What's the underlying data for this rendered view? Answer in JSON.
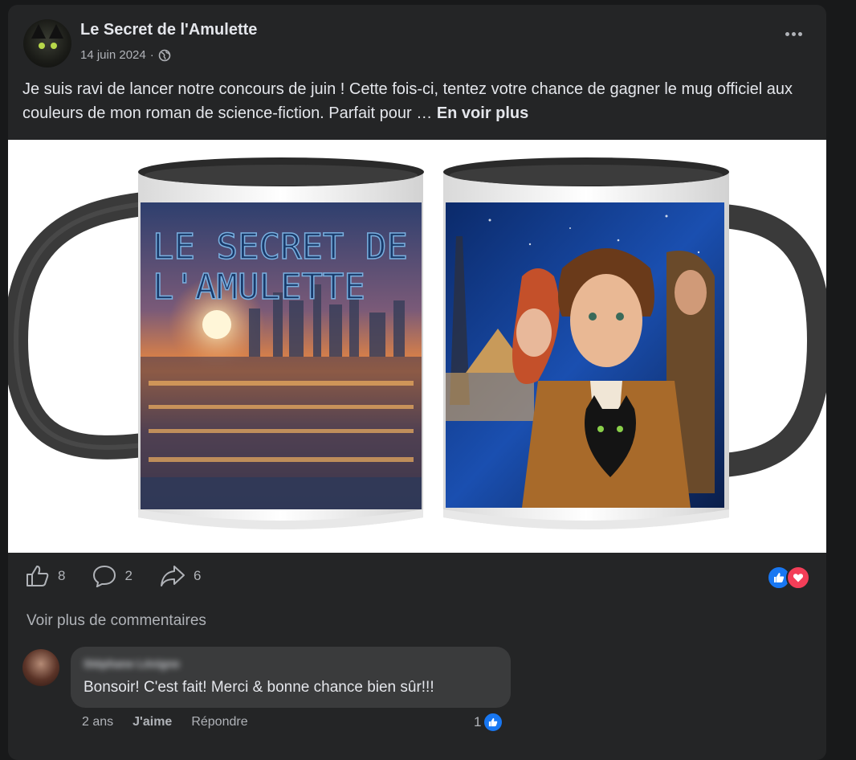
{
  "post": {
    "author": "Le Secret de l'Amulette",
    "date": "14 juin 2024",
    "separator": "·",
    "audience_icon": "globe-icon",
    "text": "Je suis ravi de lancer notre concours de juin ! Cette fois-ci, tentez votre chance de gagner le mug officiel aux couleurs de mon roman de science-fiction. Parfait pour …",
    "see_more": "En voir plus",
    "mug_logo_line1": "LE SECRET DE",
    "mug_logo_line2": "L'AMULETTE"
  },
  "stats": {
    "likes": "8",
    "comments": "2",
    "shares": "6",
    "reactions": [
      "like-reaction-icon",
      "love-reaction-icon"
    ]
  },
  "comments": {
    "view_more": "Voir plus de commentaires",
    "items": [
      {
        "author": "Stéphane Lévigne",
        "text": "Bonsoir! C'est fait! Merci & bonne chance bien sûr!!!",
        "time": "2 ans",
        "like_action": "J'aime",
        "reply_action": "Répondre",
        "like_count": "1"
      }
    ]
  },
  "colors": {
    "background": "#18191a",
    "card": "#242526",
    "bubble": "#3a3b3c",
    "like_blue": "#1877f2",
    "love_red": "#f33e58"
  }
}
